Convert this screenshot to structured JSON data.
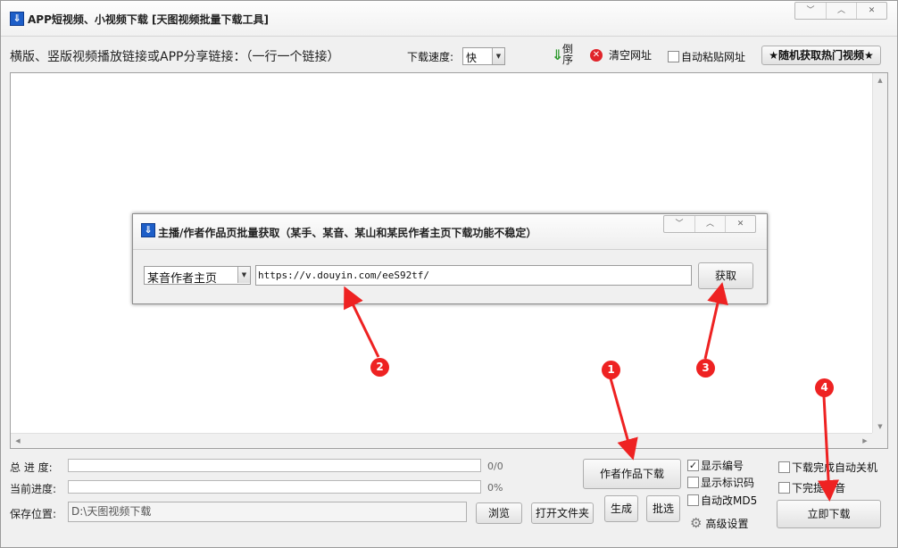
{
  "window": {
    "title": "APP短视频、小视频下载 [天图视频批量下载工具]",
    "controls": [
      "﹀",
      "︿",
      "✕"
    ]
  },
  "toolbar": {
    "prompt": "横版、竖版视频播放链接或APP分享链接：（一行一个链接）",
    "speed_label": "下载速度:",
    "speed_value": "快",
    "reverse_label": "倒序",
    "clear_label": "清空网址",
    "auto_paste_label": "自动粘贴网址",
    "auto_paste_checked": false,
    "random_button": "★随机获取热门视频★"
  },
  "dialog": {
    "title": "主播/作者作品页批量获取（某手、某音、某山和某民作者主页下载功能不稳定）",
    "controls": [
      "﹀",
      "︿",
      "✕"
    ],
    "source_value": "某音作者主页",
    "url_value": "https://v.douyin.com/eeS92tf/",
    "fetch_button": "获取"
  },
  "progress": {
    "total_label": "总 进 度:",
    "total_value": "0/0",
    "total_fraction": 0,
    "current_label": "当前进度:",
    "current_value": "0%",
    "current_fraction": 0
  },
  "save": {
    "label": "保存位置:",
    "path": "D:\\天图视频下载",
    "browse_button": "浏览",
    "open_folder_button": "打开文件夹"
  },
  "actions": {
    "author_download_button": "作者作品下载",
    "generate_button": "生成",
    "pick_button": "批选",
    "start_download_button": "立即下载",
    "advanced_settings": "高级设置"
  },
  "options": {
    "show_number": {
      "label": "显示编号",
      "checked": true
    },
    "show_watermark": {
      "label": "显示标识码",
      "checked": false
    },
    "auto_md5": {
      "label": "自动改MD5",
      "checked": false
    },
    "auto_shutdown": {
      "label": "下载完成自动关机",
      "checked": false
    },
    "sound_prompt": {
      "label": "下完提示音",
      "checked": false
    }
  },
  "annotations": {
    "markers": [
      "1",
      "2",
      "3",
      "4"
    ],
    "color": "#ee2222"
  }
}
